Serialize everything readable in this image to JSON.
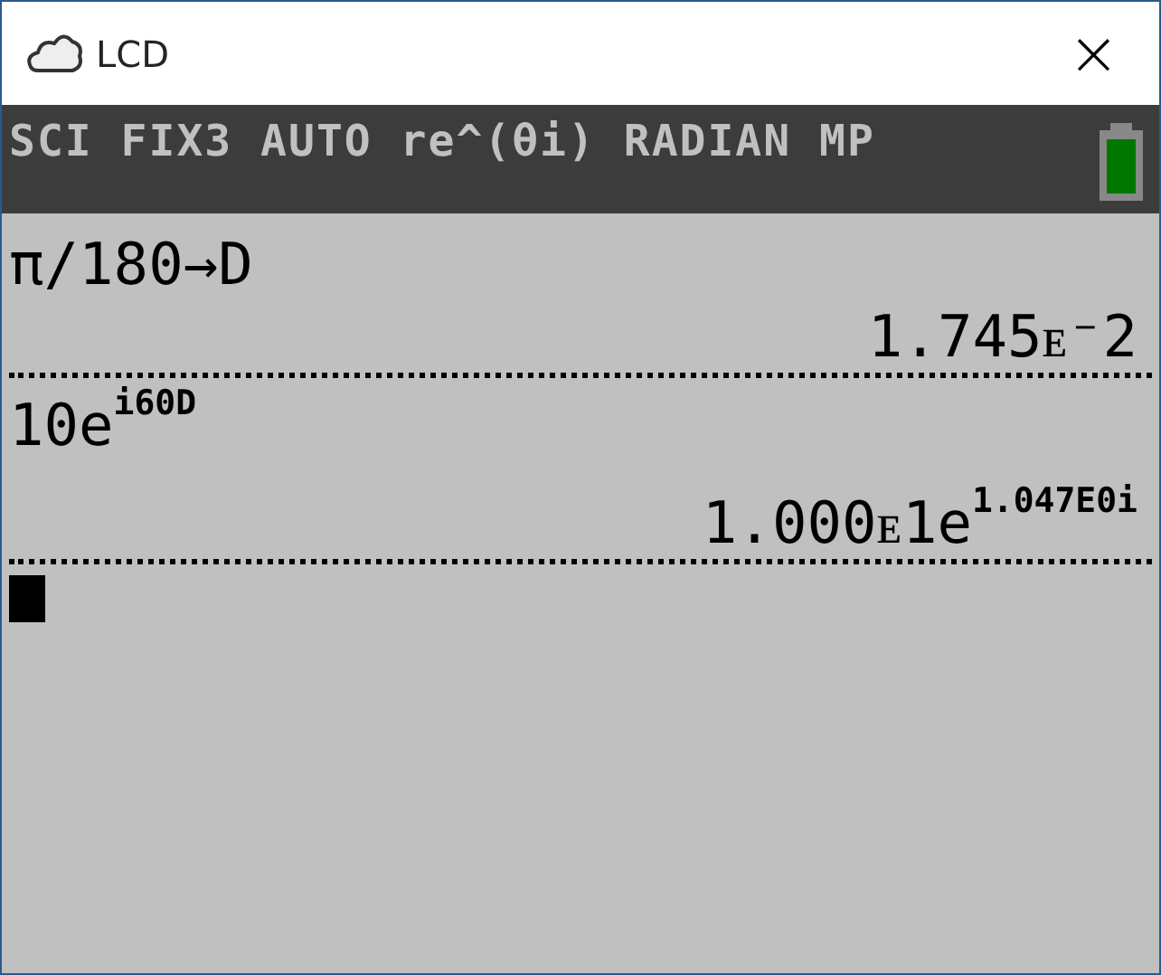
{
  "window": {
    "title": "LCD",
    "close": "×"
  },
  "status_bar": {
    "modes": "SCI FIX3 AUTO re^(θi) RADIAN MP"
  },
  "history": [
    {
      "input": "π/180→D",
      "result": "1.745ᴇ⁻2"
    },
    {
      "input": "10e$^{i60D}$",
      "result": "1.000ᴇ1e$^{1.047E0i}$"
    }
  ],
  "cursor": {
    "visible": true
  }
}
